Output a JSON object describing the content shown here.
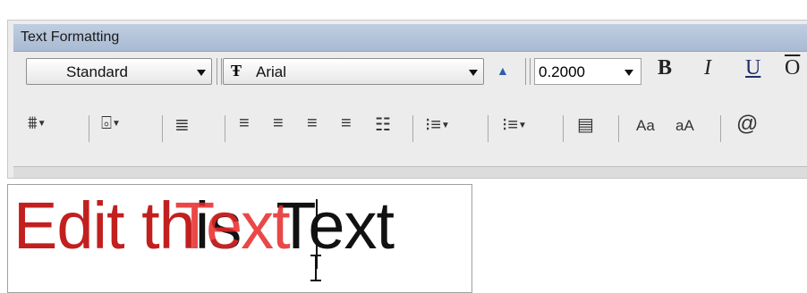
{
  "window": {
    "title": "Text Formatting"
  },
  "toolbar": {
    "style_value": "Standard",
    "font_value": "Arial",
    "height_value": "0.2000",
    "bold_label": "B",
    "italic_label": "I",
    "underline_label": "U",
    "overline_label": "O",
    "case_upper_label": "Aa",
    "case_lower_label": "aA",
    "symbol_label": "@"
  },
  "icons": {
    "row2": [
      "stack-icon",
      "columns-icon",
      "mtext-justify-icon",
      "align-left-icon",
      "align-center-icon",
      "align-right-icon",
      "justify-icon",
      "distribute-icon",
      "line-spacing-icon",
      "numbering-icon",
      "insert-field-icon"
    ]
  },
  "editor": {
    "text_part1": "Edit th",
    "text_part2": "is",
    "text_overlay": "Text",
    "text_part3": "Text"
  },
  "colors": {
    "title_bar": "#a9bad3",
    "edit_text_red": "#c21f1f",
    "overlay_red": "#e62828"
  }
}
